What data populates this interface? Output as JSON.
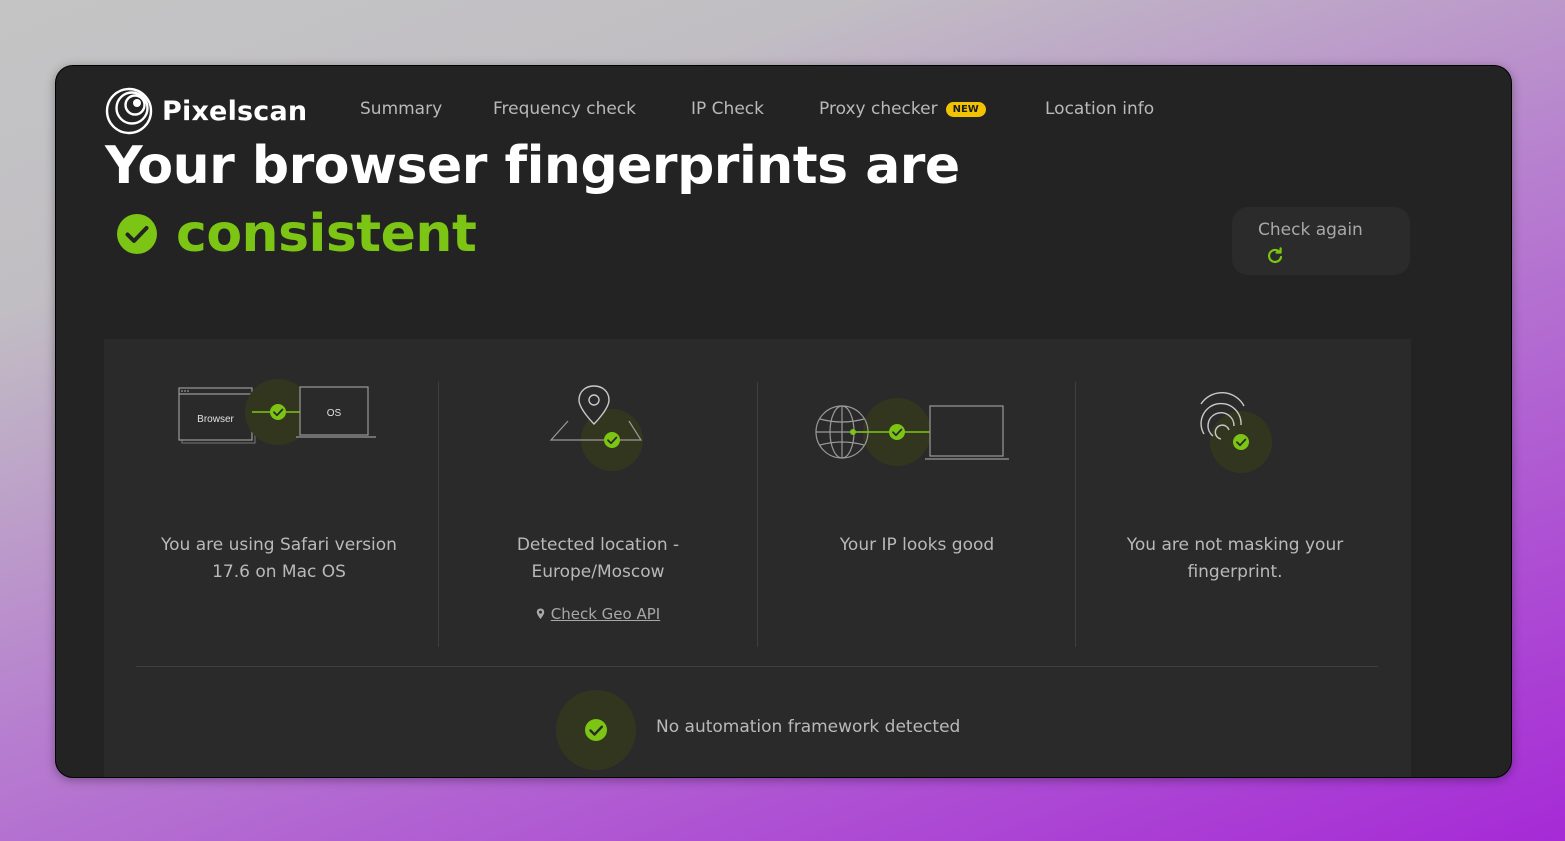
{
  "app": {
    "logo_text": "Pixelscan"
  },
  "nav": {
    "items": [
      {
        "label": "Summary"
      },
      {
        "label": "Frequency check"
      },
      {
        "label": "IP Check"
      },
      {
        "label": "Proxy checker",
        "badge": "NEW"
      },
      {
        "label": "Location info"
      }
    ]
  },
  "headline": {
    "line1": "Your browser fingerprints are",
    "status_word": "consistent",
    "status_icon": "check-circle-icon"
  },
  "check_again": {
    "label": "Check again",
    "icon": "refresh-icon"
  },
  "checks": [
    {
      "text": "You are using Safari version 17.6 on Mac OS",
      "illustration": {
        "left_label": "Browser",
        "right_label": "OS"
      }
    },
    {
      "text": "Detected location - Europe/Moscow",
      "link": {
        "label": "Check Geo API",
        "icon": "location-pin-icon"
      }
    },
    {
      "text": "Your IP looks good"
    },
    {
      "text": "You are not masking your fingerprint."
    }
  ],
  "automation": {
    "text": "No automation framework detected"
  },
  "colors": {
    "accent_green": "#7cc514",
    "badge_yellow": "#f2c300",
    "card_background": "#232323"
  }
}
